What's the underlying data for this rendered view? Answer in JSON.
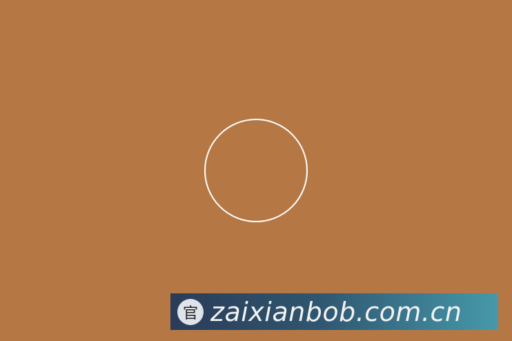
{
  "screen": {
    "background_color": "#b57845",
    "ring_color": "#ffffff"
  },
  "watermark": {
    "badge_text": "官",
    "domain": "zaixianbob.com.cn"
  }
}
